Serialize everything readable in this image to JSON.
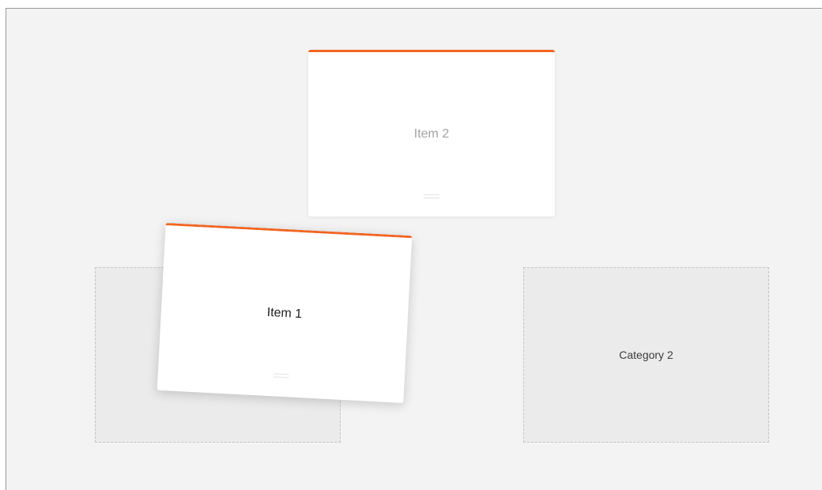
{
  "colors": {
    "accent": "#f26522",
    "background": "#f3f3f3",
    "dropzone": "#ebebeb"
  },
  "categories": [
    {
      "label": ""
    },
    {
      "label": "Category 2"
    }
  ],
  "items": [
    {
      "label": "Item 2",
      "icon": "drag-handle-icon"
    },
    {
      "label": "Item 1",
      "icon": "drag-handle-icon"
    }
  ]
}
